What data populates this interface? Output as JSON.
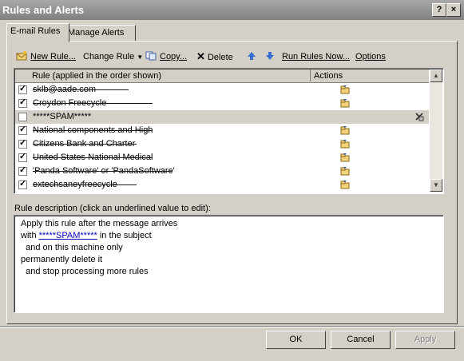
{
  "window": {
    "title": "Rules and Alerts",
    "help_label": "?",
    "close_label": "×"
  },
  "tabs": [
    {
      "label": "E-mail Rules"
    },
    {
      "label": "Manage Alerts"
    }
  ],
  "toolbar": {
    "new_rule": "New Rule...",
    "change_rule": "Change Rule",
    "copy": "Copy...",
    "delete": "Delete",
    "run_rules": "Run Rules Now...",
    "options": "Options"
  },
  "rules_list": {
    "col_rule": "Rule (applied in the order shown)",
    "col_actions": "Actions",
    "rows": [
      {
        "name": "sklb@aade.com",
        "checked": true,
        "redacted": true
      },
      {
        "name": "Croydon Freecycle",
        "checked": true,
        "redacted": true
      },
      {
        "name": "*****SPAM*****",
        "checked": false,
        "redacted": false
      },
      {
        "name": "National components and High",
        "checked": true,
        "redacted": true
      },
      {
        "name": "Citizens Bank and Charter",
        "checked": true,
        "redacted": true
      },
      {
        "name": "United States National Medical",
        "checked": true,
        "redacted": true
      },
      {
        "name": "'Panda Software' or 'PandaSoftware'",
        "checked": true,
        "redacted": true
      },
      {
        "name": "extechsaneyfreecycle",
        "checked": true,
        "redacted": true
      }
    ]
  },
  "description": {
    "label": "Rule description (click an underlined value to edit):",
    "line1": "Apply this rule after the message arrives",
    "line2_pre": "with ",
    "line2_link": "*****SPAM*****",
    "line2_post": " in the subject",
    "line3": "  and on this machine only",
    "line4": "permanently delete it",
    "line5": "  and stop processing more rules"
  },
  "buttons": {
    "ok": "OK",
    "cancel": "Cancel",
    "apply": "Apply"
  }
}
